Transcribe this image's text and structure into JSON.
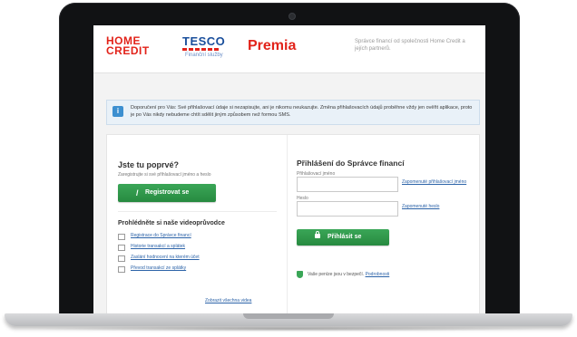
{
  "header": {
    "logo_homecredit": "HOME\nCREDIT",
    "logo_tesco": "TESCO",
    "logo_tesco_sub": "Finanční služby",
    "logo_premia": "Premia",
    "note": "Správce financí od společnosti Home Credit a jejích partnerů."
  },
  "notice": {
    "icon": "info-icon",
    "text": "Doporučení pro Vás: Své přihlašovací údaje si nezapisujte, ani je nikomu neukazujte. Změna přihlašovacích údajů proběhne vždy jen ověřit aplikace, proto je po Vás nikdy nebudeme chtít sdělit jiným způsobem než formou SMS."
  },
  "left": {
    "title": "Jste tu poprvé?",
    "subtitle": "Zaregistrujte si své přihlašovací jméno a heslo",
    "register_button": "Registrovat se",
    "videos_title": "Prohlédněte si naše videoprůvodce",
    "videos": [
      "Registrace do Správce financí",
      "Historie transakcí a splátek",
      "Zaslání hodnocení na kterém účet",
      "Převod transakcí ze splátky"
    ],
    "all_videos_link": "Zobrazit všechna videa"
  },
  "right": {
    "title": "Přihlášení do Správce financí",
    "username_label": "Přihlašovací jméno",
    "username_value": "",
    "forgot_username": "Zapomenuté přihlašovací jméno",
    "password_label": "Heslo",
    "password_value": "",
    "forgot_password": "Zapomenuté heslo",
    "login_button": "Přihlásit se",
    "safety_text": "Vaše peníze jsou v bezpečí.",
    "safety_link": "Podrobnosti"
  },
  "colors": {
    "brand_red": "#e2231a",
    "tesco_blue": "#1a4f9c",
    "button_green": "#2f9a4b",
    "link_blue": "#2c63a8"
  }
}
